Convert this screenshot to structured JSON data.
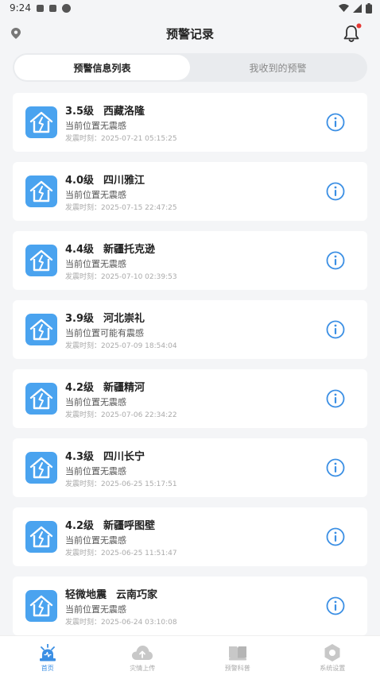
{
  "status_bar": {
    "time": "9:24"
  },
  "header": {
    "title": "预警记录"
  },
  "tabs": [
    {
      "label": "预警信息列表",
      "active": true
    },
    {
      "label": "我收到的预警",
      "active": false
    }
  ],
  "records": [
    {
      "magnitude": "3.5级",
      "location": "西藏洛隆",
      "feel": "当前位置无震感",
      "time": "发震时刻：2025-07-21 05:15:25"
    },
    {
      "magnitude": "4.0级",
      "location": "四川雅江",
      "feel": "当前位置无震感",
      "time": "发震时刻：2025-07-15 22:47:25"
    },
    {
      "magnitude": "4.4级",
      "location": "新疆托克逊",
      "feel": "当前位置无震感",
      "time": "发震时刻：2025-07-10 02:39:53"
    },
    {
      "magnitude": "3.9级",
      "location": "河北崇礼",
      "feel": "当前位置可能有震感",
      "time": "发震时刻：2025-07-09 18:54:04"
    },
    {
      "magnitude": "4.2级",
      "location": "新疆精河",
      "feel": "当前位置无震感",
      "time": "发震时刻：2025-07-06 22:34:22"
    },
    {
      "magnitude": "4.3级",
      "location": "四川长宁",
      "feel": "当前位置无震感",
      "time": "发震时刻：2025-06-25 15:17:51"
    },
    {
      "magnitude": "4.2级",
      "location": "新疆呼图壁",
      "feel": "当前位置无震感",
      "time": "发震时刻：2025-06-25 11:51:47"
    },
    {
      "magnitude": "轻微地震",
      "location": "云南巧家",
      "feel": "当前位置无震感",
      "time": "发震时刻：2025-06-24 03:10:08"
    }
  ],
  "bottom_nav": [
    {
      "label": "首页",
      "icon": "alarm-icon",
      "active": true
    },
    {
      "label": "灾情上传",
      "icon": "cloud-upload-icon",
      "active": false
    },
    {
      "label": "预警科普",
      "icon": "book-icon",
      "active": false
    },
    {
      "label": "系统设置",
      "icon": "gear-icon",
      "active": false
    }
  ],
  "colors": {
    "accent": "#3b8fe4",
    "card_icon": "#4aa3ef",
    "notification_dot": "#e53935"
  }
}
